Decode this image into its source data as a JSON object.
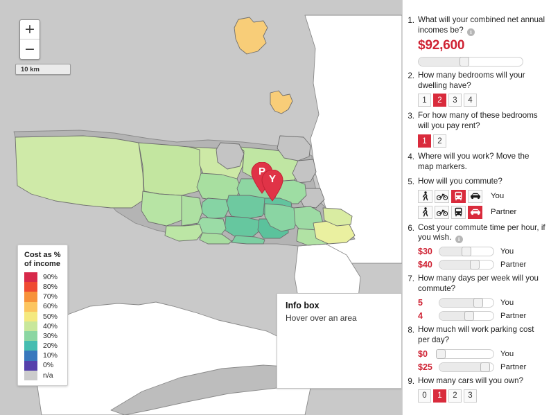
{
  "map": {
    "zoom_in_label": "+",
    "zoom_out_label": "−",
    "scale_label": "10 km",
    "markers": [
      {
        "letter": "P",
        "name": "partner"
      },
      {
        "letter": "Y",
        "name": "you"
      }
    ],
    "legend": {
      "title": "Cost as %\nof income",
      "entries": [
        {
          "label": "90%",
          "color": "#d7294a"
        },
        {
          "label": "80%",
          "color": "#ef4a32"
        },
        {
          "label": "70%",
          "color": "#f7923a"
        },
        {
          "label": "60%",
          "color": "#fcc55f"
        },
        {
          "label": "50%",
          "color": "#f4e97f"
        },
        {
          "label": "40%",
          "color": "#c8e79b"
        },
        {
          "label": "30%",
          "color": "#8bd6a2"
        },
        {
          "label": "20%",
          "color": "#45bdb0"
        },
        {
          "label": "10%",
          "color": "#3878bd"
        },
        {
          "label": "0%",
          "color": "#5540ab"
        },
        {
          "label": "n/a",
          "color": "#cccccc"
        }
      ]
    },
    "info_box": {
      "title": "Info box",
      "text": "Hover over an area"
    }
  },
  "sidebar": {
    "questions": [
      {
        "num": "1.",
        "text": "What will your combined net annual incomes be?",
        "has_info_icon": true,
        "value": "$92,600",
        "slider_pct": 44
      },
      {
        "num": "2.",
        "text": "How many bedrooms will your dwelling have?",
        "options": [
          "1",
          "2",
          "3",
          "4"
        ],
        "selected": "2"
      },
      {
        "num": "3.",
        "text": "For how many of these bedrooms will you pay rent?",
        "options": [
          "1",
          "2"
        ],
        "selected": "1"
      },
      {
        "num": "4.",
        "text": "Where will you work? Move the map markers."
      },
      {
        "num": "5.",
        "text": "How will you commute?",
        "modes": [
          "walk",
          "bike",
          "bus",
          "car"
        ],
        "rows": [
          {
            "label": "You",
            "selected": "bus"
          },
          {
            "label": "Partner",
            "selected": "car"
          }
        ]
      },
      {
        "num": "6.",
        "text": "Cost your commute time per hour, if you wish.",
        "has_info_icon": true,
        "rows": [
          {
            "value": "$30",
            "label": "You",
            "pct": 50
          },
          {
            "value": "$40",
            "label": "Partner",
            "pct": 65
          }
        ]
      },
      {
        "num": "7.",
        "text": "How many days per week will you commute?",
        "rows": [
          {
            "value": "5",
            "label": "You",
            "pct": 72
          },
          {
            "value": "4",
            "label": "Partner",
            "pct": 55
          }
        ]
      },
      {
        "num": "8.",
        "text": "How much will work parking cost per day?",
        "rows": [
          {
            "value": "$0",
            "label": "You",
            "pct": 3
          },
          {
            "value": "$25",
            "label": "Partner",
            "pct": 84,
            "focused": true
          }
        ]
      },
      {
        "num": "9.",
        "text": "How many cars will you own?",
        "options": [
          "0",
          "1",
          "2",
          "3"
        ],
        "selected": "1"
      }
    ]
  }
}
